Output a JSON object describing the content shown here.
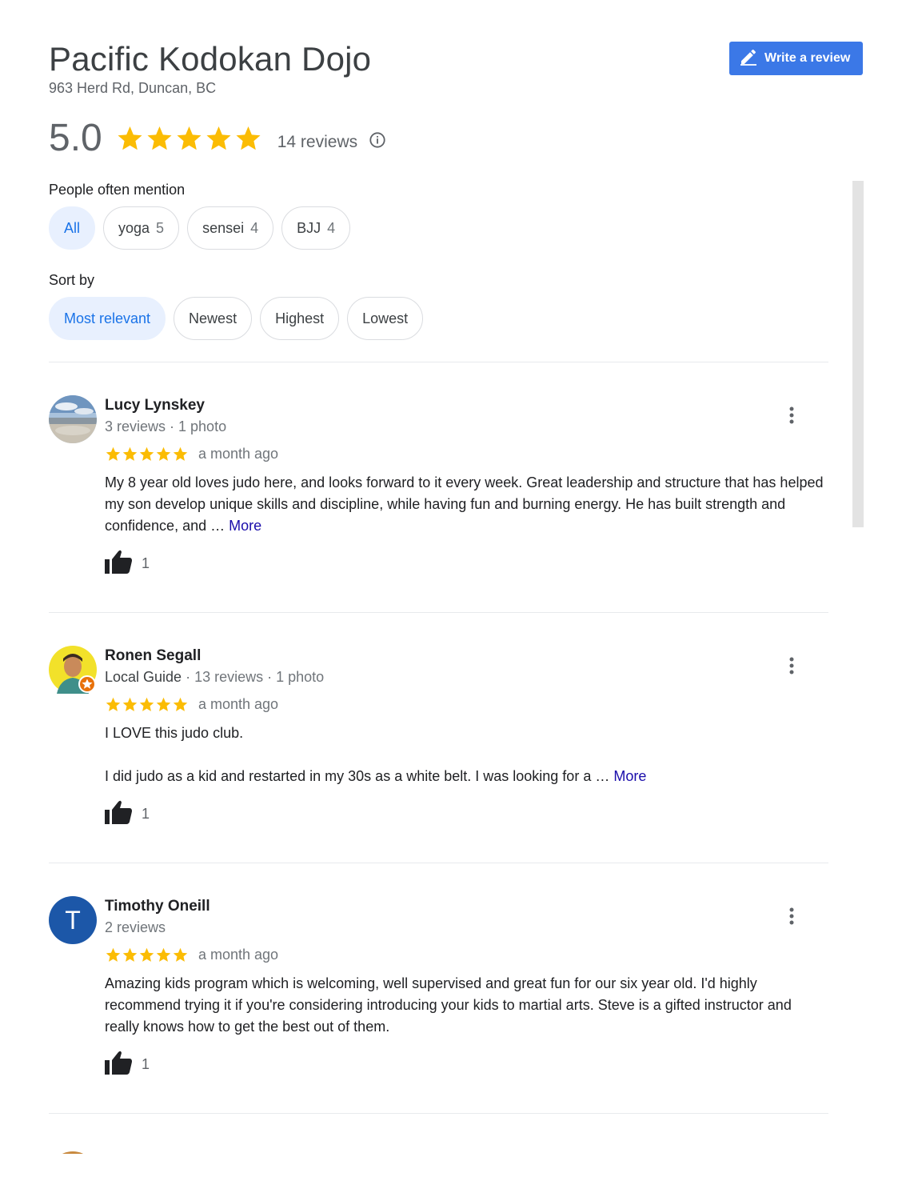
{
  "place": {
    "name": "Pacific Kodokan Dojo",
    "address": "963 Herd Rd, Duncan, BC"
  },
  "write_review": {
    "label": "Write a review"
  },
  "rating": {
    "score": "5.0",
    "stars": 5,
    "reviews_label": "14 reviews"
  },
  "mentions": {
    "label": "People often mention",
    "chips": [
      {
        "label": "All",
        "count": ""
      },
      {
        "label": "yoga",
        "count": "5"
      },
      {
        "label": "sensei",
        "count": "4"
      },
      {
        "label": "BJJ",
        "count": "4"
      }
    ]
  },
  "sort": {
    "label": "Sort by",
    "options": [
      "Most relevant",
      "Newest",
      "Highest",
      "Lowest"
    ]
  },
  "reviews": [
    {
      "name": "Lucy Lynskey",
      "meta": "3 reviews · 1 photo",
      "stars": 5,
      "date": "a month ago",
      "text": "My 8 year old loves judo here, and looks forward to it every week. Great leadership and structure that has helped my son develop unique skills and discipline, while having fun and burning energy. He has built strength and confidence, and …",
      "more": "More",
      "likes": "1"
    },
    {
      "name": "Ronen Segall",
      "guide": "Local Guide",
      "meta": " · 13 reviews · 1 photo",
      "stars": 5,
      "date": "a month ago",
      "text1": "I LOVE this judo club.",
      "text2": "I did judo as a kid and restarted in my 30s as a white belt. I was looking for a …",
      "more": "More",
      "likes": "1"
    },
    {
      "name": "Timothy Oneill",
      "initial": "T",
      "meta": "2 reviews",
      "stars": 5,
      "date": "a month ago",
      "text": "Amazing kids program which is welcoming, well supervised and great fun for our six year old. I'd highly recommend trying it if you're considering introducing your kids to martial arts. Steve is a gifted instructor and really knows how to get the best out of them.",
      "likes": "1"
    }
  ],
  "colors": {
    "star": "#fbbc04",
    "accent": "#3b78e7",
    "link": "#1a0dab",
    "chip_active_bg": "#e8f0fe",
    "chip_active_text": "#1a73e8"
  },
  "icons": [
    "pencil-icon",
    "star-icon",
    "info-icon",
    "thumbs-up-icon",
    "more-vert-icon",
    "local-guide-badge-icon"
  ]
}
